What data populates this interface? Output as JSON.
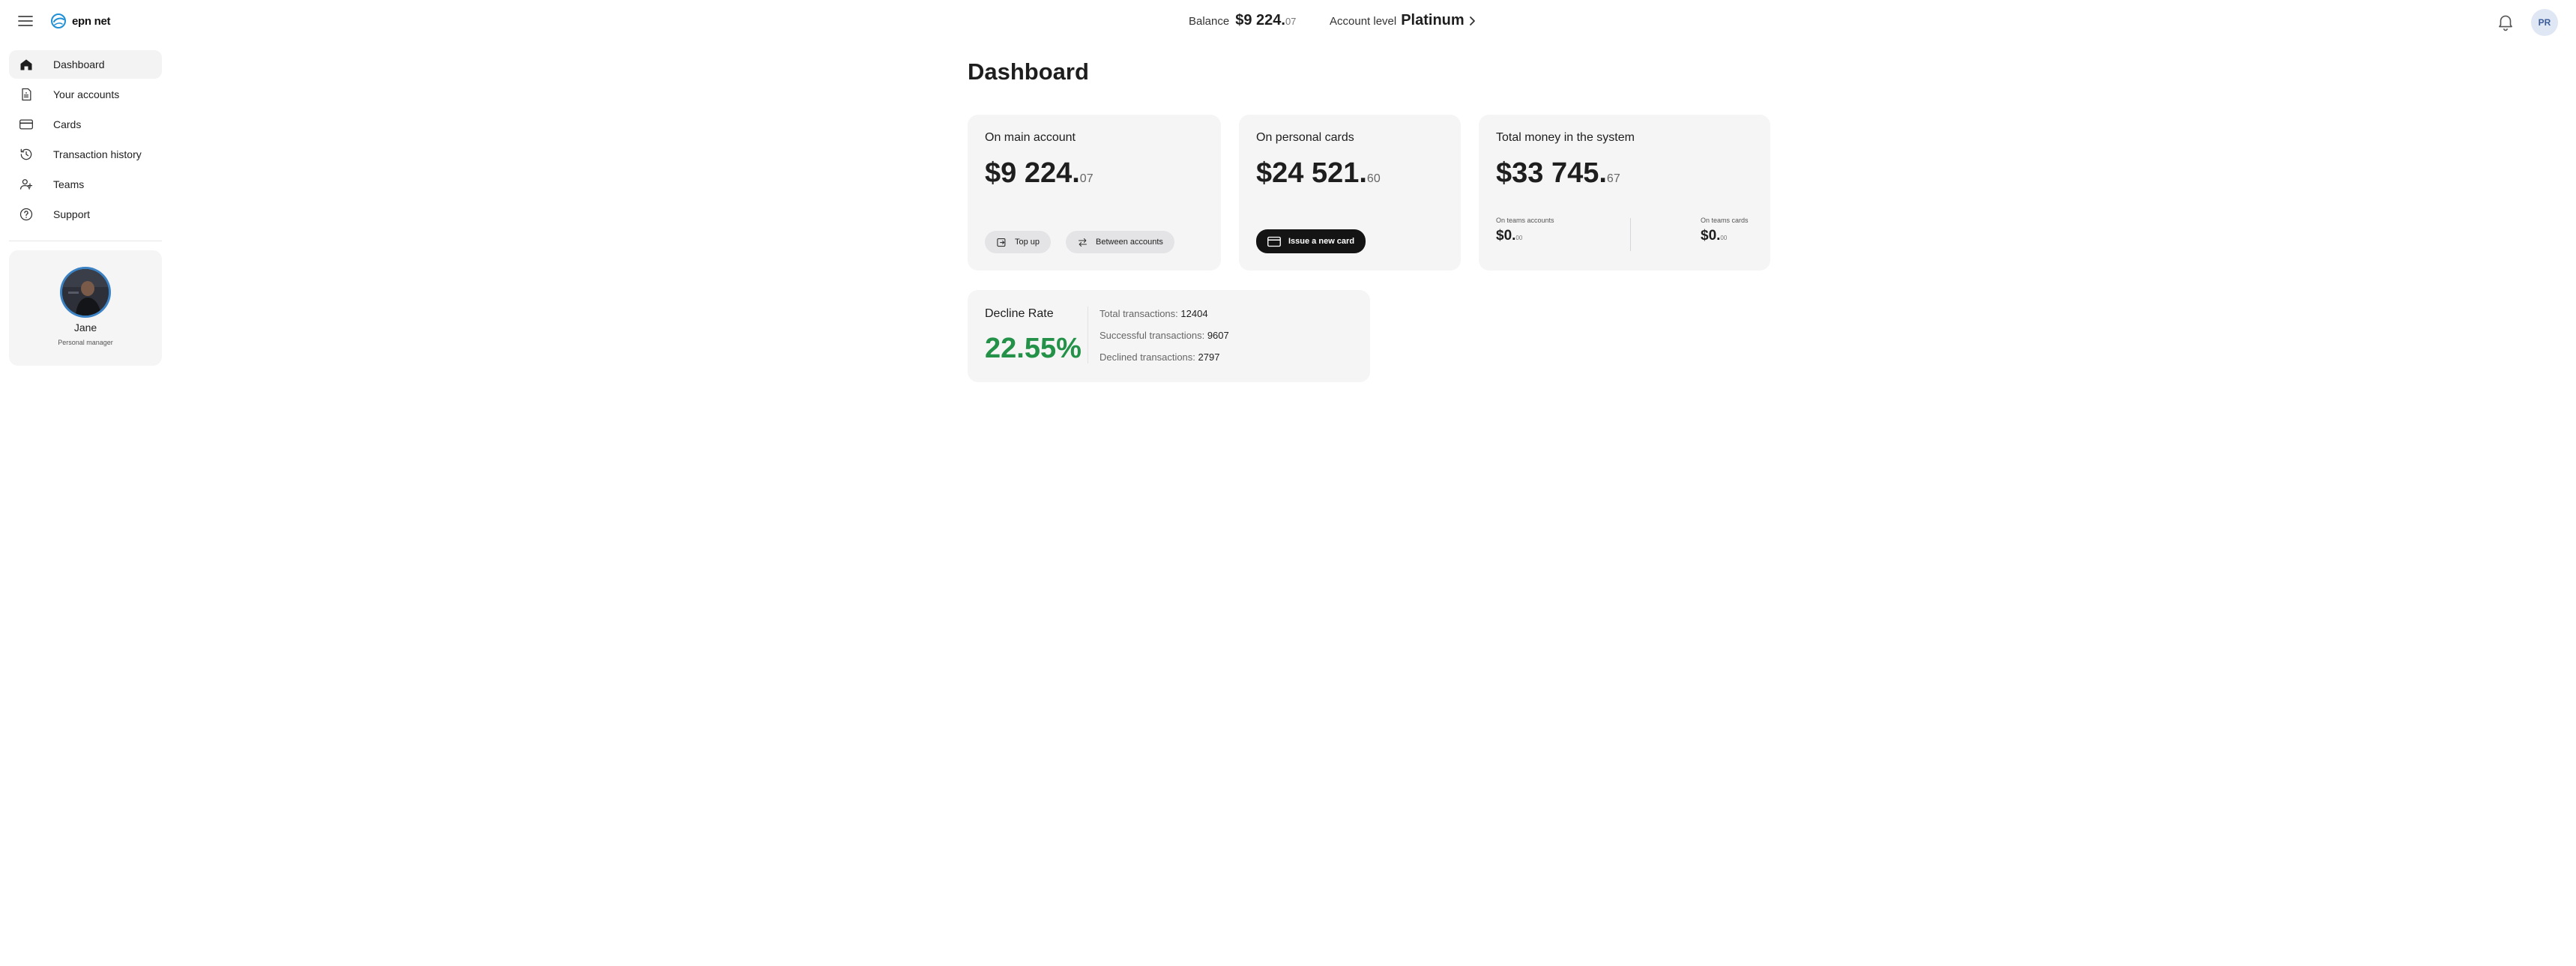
{
  "header": {
    "logo_text": "epn net",
    "balance_label": "Balance",
    "balance_amount": "$9 224.",
    "balance_cents": "07",
    "account_level_label": "Account level",
    "account_level_value": "Platinum",
    "user_initials": "PR"
  },
  "sidebar": {
    "items": [
      {
        "label": "Dashboard",
        "icon": "home-icon"
      },
      {
        "label": "Your accounts",
        "icon": "document-icon"
      },
      {
        "label": "Cards",
        "icon": "card-icon"
      },
      {
        "label": "Transaction history",
        "icon": "history-icon"
      },
      {
        "label": "Teams",
        "icon": "users-icon"
      },
      {
        "label": "Support",
        "icon": "help-icon"
      }
    ],
    "active_item": "Dashboard",
    "manager": {
      "name": "Jane",
      "role": "Personal manager"
    }
  },
  "main": {
    "title": "Dashboard",
    "main_account": {
      "title": "On main account",
      "amount": "$9 224.",
      "cents": "07",
      "top_up_label": "Top up",
      "between_label": "Between accounts"
    },
    "personal_cards": {
      "title": "On personal cards",
      "amount": "$24 521.",
      "cents": "60",
      "issue_label": "Issue a new card"
    },
    "total_money": {
      "title": "Total money in the system",
      "amount": "$33 745.",
      "cents": "67",
      "teams_accounts_label": "On teams accounts",
      "teams_accounts_amount": "$0.",
      "teams_accounts_cents": "00",
      "teams_cards_label": "On teams cards",
      "teams_cards_amount": "$0.",
      "teams_cards_cents": "00"
    },
    "decline_rate": {
      "title": "Decline Rate",
      "value": "22.55%",
      "total_label": "Total transactions:",
      "total_value": "12404",
      "successful_label": "Successful transactions:",
      "successful_value": "9607",
      "declined_label": "Declined transactions:",
      "declined_value": "2797"
    }
  },
  "colors": {
    "accent_green": "#239147",
    "card_background": "#f5f5f6",
    "dark_button": "#141414",
    "logo_blue": "#1f8fd6"
  }
}
